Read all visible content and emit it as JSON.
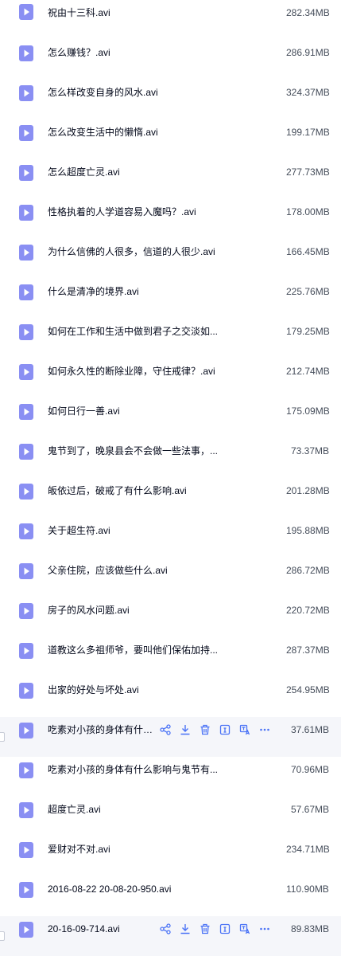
{
  "files": [
    {
      "name": "祝由十三科.avi",
      "size": "282.34MB"
    },
    {
      "name": "怎么赚钱？.avi",
      "size": "286.91MB"
    },
    {
      "name": "怎么样改变自身的风水.avi",
      "size": "324.37MB"
    },
    {
      "name": "怎么改变生活中的懒惰.avi",
      "size": "199.17MB"
    },
    {
      "name": "怎么超度亡灵.avi",
      "size": "277.73MB"
    },
    {
      "name": "性格执着的人学道容易入魔吗？.avi",
      "size": "178.00MB"
    },
    {
      "name": "为什么信佛的人很多，信道的人很少.avi",
      "size": "166.45MB"
    },
    {
      "name": "什么是清净的境界.avi",
      "size": "225.76MB"
    },
    {
      "name": "如何在工作和生活中做到君子之交淡如...",
      "size": "179.25MB"
    },
    {
      "name": "如何永久性的断除业障，守住戒律？.avi",
      "size": "212.74MB"
    },
    {
      "name": "如何日行一善.avi",
      "size": "175.09MB"
    },
    {
      "name": "鬼节到了，晚泉县会不会做一些法事，...",
      "size": "73.37MB"
    },
    {
      "name": "皈依过后，破戒了有什么影响.avi",
      "size": "201.28MB"
    },
    {
      "name": "关于超生符.avi",
      "size": "195.88MB"
    },
    {
      "name": "父亲住院，应该做些什么.avi",
      "size": "286.72MB"
    },
    {
      "name": "房子的风水问题.avi",
      "size": "220.72MB"
    },
    {
      "name": "道教这么多祖师爷，要叫他们保佑加持...",
      "size": "287.37MB"
    },
    {
      "name": "出家的好处与坏处.avi",
      "size": "254.95MB"
    },
    {
      "name": "吃素对小孩的身体有什么影响与鬼节有...",
      "size": "37.61MB"
    },
    {
      "name": "吃素对小孩的身体有什么影响与鬼节有...",
      "size": "70.96MB"
    },
    {
      "name": "超度亡灵.avi",
      "size": "57.67MB"
    },
    {
      "name": "爱财对不对.avi",
      "size": "234.71MB"
    },
    {
      "name": "2016-08-22 20-08-20-950.avi",
      "size": "110.90MB"
    },
    {
      "name": "20-16-09-714.avi",
      "size": "89.83MB"
    }
  ],
  "hover_rows": [
    18,
    23
  ],
  "colors": {
    "icon": "#8a8ff3",
    "action": "#4b73f6"
  },
  "action_icons": [
    "share-icon",
    "download-icon",
    "delete-icon",
    "info-icon",
    "translate-icon",
    "more-icon"
  ]
}
